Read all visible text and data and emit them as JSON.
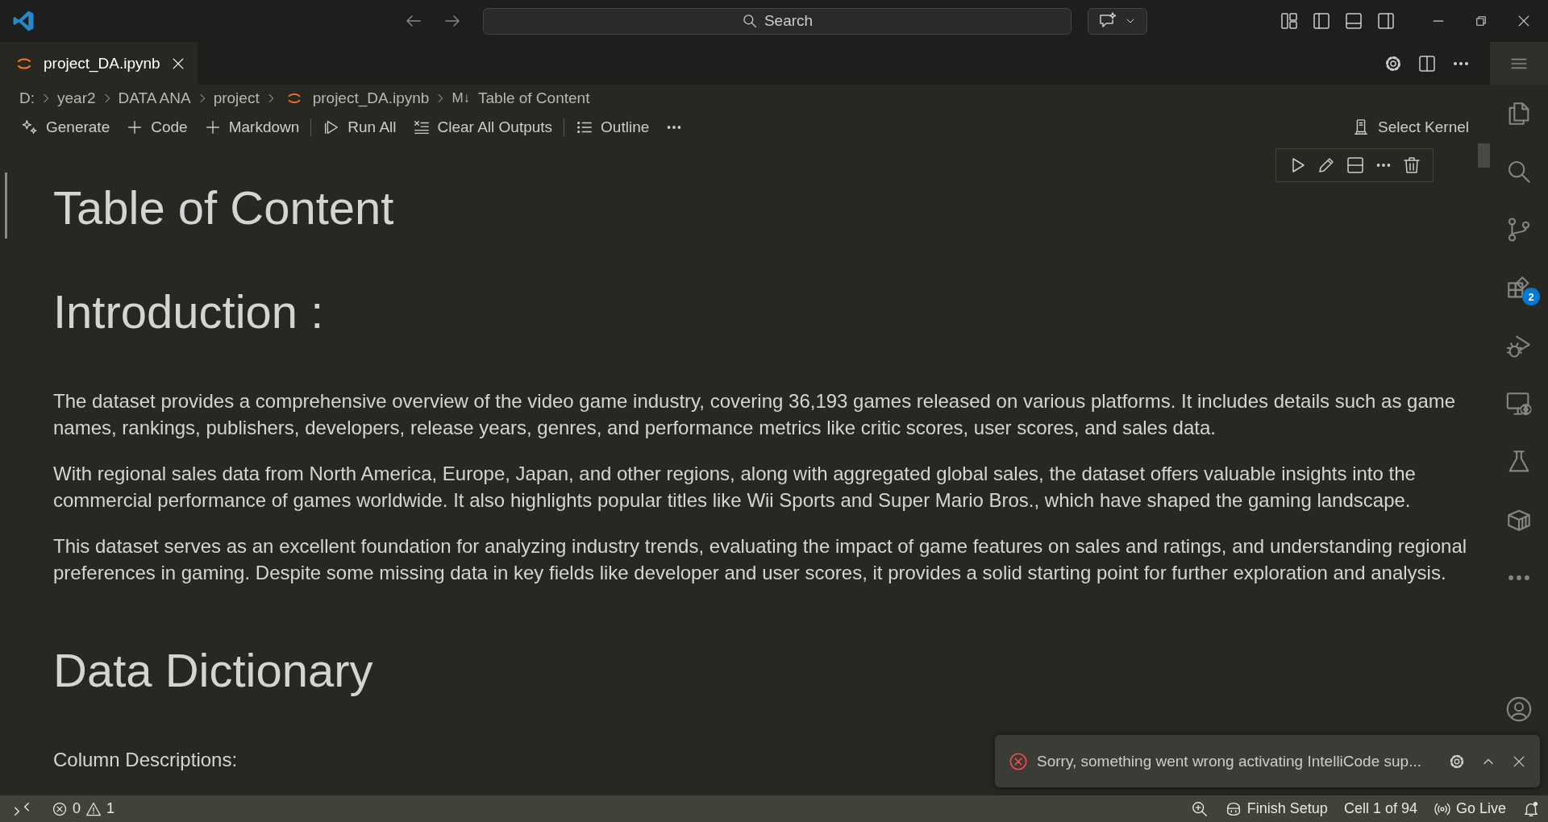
{
  "title_bar": {
    "search": {
      "placeholder": "Search"
    }
  },
  "tabs": [
    {
      "label": "project_DA.ipynb",
      "selected": true
    }
  ],
  "breadcrumb": [
    {
      "label": "D:",
      "kind": "folder"
    },
    {
      "label": "year2",
      "kind": "folder"
    },
    {
      "label": "DATA ANA",
      "kind": "folder"
    },
    {
      "label": "project",
      "kind": "folder"
    },
    {
      "label": "project_DA.ipynb",
      "kind": "notebook"
    },
    {
      "label": "Table of Content",
      "kind": "markdown",
      "badge": "M↓"
    }
  ],
  "toolbar": {
    "items": [
      {
        "label": "Generate",
        "kind": "generate"
      },
      {
        "label": "Code",
        "kind": "add"
      },
      {
        "label": "Markdown",
        "kind": "add"
      },
      {
        "kind": "separator"
      },
      {
        "label": "Run All",
        "kind": "run"
      },
      {
        "label": "Clear All Outputs",
        "kind": "clear"
      },
      {
        "kind": "separator"
      },
      {
        "label": "Outline",
        "kind": "outline"
      },
      {
        "kind": "more"
      }
    ],
    "kernel": "Select Kernel"
  },
  "cell": {
    "blocks": [
      {
        "kind": "h1",
        "text": "Table of Content"
      },
      {
        "kind": "h1",
        "text": "Introduction :"
      },
      {
        "kind": "p",
        "text": "The dataset provides a comprehensive overview of the video game industry, covering 36,193 games released on various platforms. It includes details such as game names, rankings, publishers, developers, release years, genres, and performance metrics like critic scores, user scores, and sales data."
      },
      {
        "kind": "p",
        "text": "With regional sales data from North America, Europe, Japan, and other regions, along with aggregated global sales, the dataset offers valuable insights into the commercial performance of games worldwide. It also highlights popular titles like Wii Sports and Super Mario Bros., which have shaped the gaming landscape."
      },
      {
        "kind": "p",
        "text": "This dataset serves as an excellent foundation for analyzing industry trends, evaluating the impact of game features on sales and ratings, and understanding regional preferences in gaming. Despite some missing data in key fields like developer and user scores, it provides a solid starting point for further exploration and analysis."
      },
      {
        "kind": "h1",
        "text": "Data Dictionary"
      },
      {
        "kind": "p",
        "text": "Column Descriptions:"
      }
    ]
  },
  "activity_bar": {
    "items": [
      {
        "kind": "explorer"
      },
      {
        "kind": "search"
      },
      {
        "kind": "source-control"
      },
      {
        "kind": "extensions",
        "badge": "2"
      },
      {
        "kind": "run-debug"
      },
      {
        "kind": "remote"
      },
      {
        "kind": "testing"
      },
      {
        "kind": "containers"
      },
      {
        "kind": "more"
      }
    ]
  },
  "notification": {
    "kind": "error",
    "message": "Sorry, something went wrong activating IntelliCode sup..."
  },
  "status_bar": {
    "errors": "0",
    "warnings": "1",
    "items": [
      {
        "kind": "zoom"
      },
      {
        "kind": "copilot",
        "label": "Finish Setup"
      },
      {
        "kind": "text",
        "label": "Cell 1 of 94"
      },
      {
        "kind": "live",
        "label": "Go Live"
      },
      {
        "kind": "bell"
      }
    ]
  }
}
